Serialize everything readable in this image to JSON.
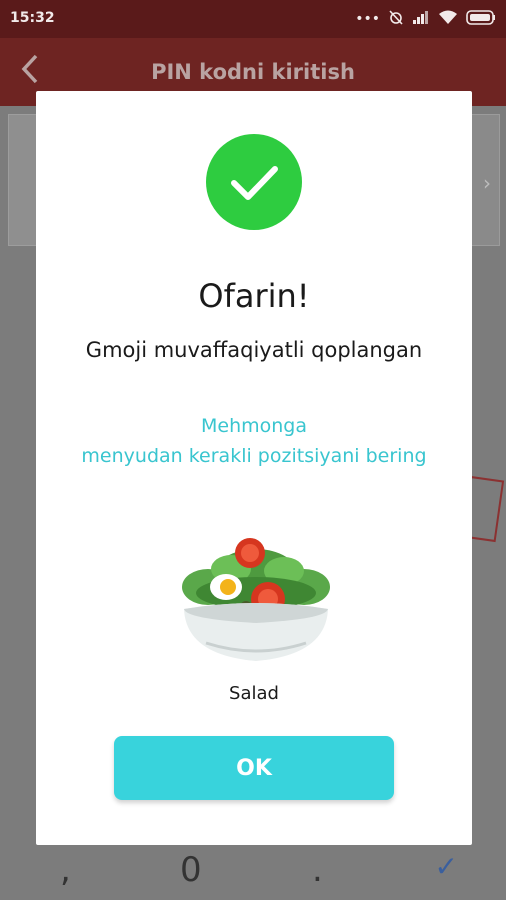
{
  "status_bar": {
    "time": "15:32",
    "icons": [
      "more-dots-icon",
      "alarm-off-icon",
      "signal-icon",
      "wifi-icon",
      "battery-icon"
    ]
  },
  "app_bar": {
    "title": "PIN kodni kiritish"
  },
  "keypad": {
    "keys": [
      ",",
      "0",
      "."
    ]
  },
  "dialog": {
    "title": "Ofarin!",
    "message": "Gmoji muvaffaqiyatli qoplangan",
    "hint_line1": "Mehmonga",
    "hint_line2": "menyudan kerakli pozitsiyani bering",
    "emoji_name": "Salad",
    "ok_label": "OK"
  },
  "colors": {
    "status_bar": "#5a1a1a",
    "app_bar": "#6e2422",
    "success": "#2ecc40",
    "accent": "#39c5cf",
    "button": "#38d3dc"
  }
}
